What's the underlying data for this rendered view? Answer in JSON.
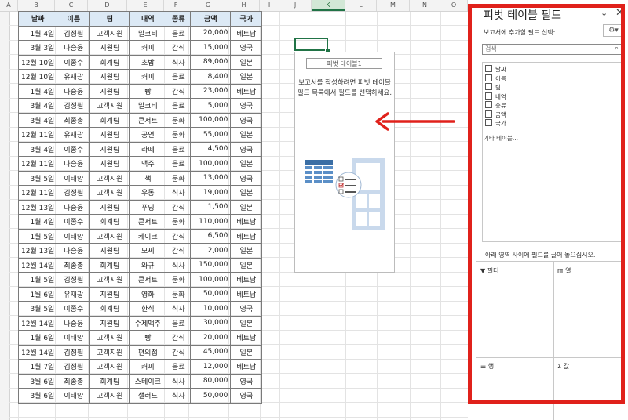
{
  "columns": [
    "A",
    "B",
    "C",
    "D",
    "E",
    "F",
    "G",
    "H",
    "I",
    "J",
    "K",
    "L",
    "M",
    "N",
    "O"
  ],
  "selected_column": "K",
  "table": {
    "headers": [
      "날짜",
      "이름",
      "팀",
      "내역",
      "종류",
      "금액",
      "국가"
    ],
    "rows": [
      [
        "1월 4일",
        "김정필",
        "고객지원",
        "밀크티",
        "음료",
        "20,000",
        "베트남"
      ],
      [
        "3월 3일",
        "나승윤",
        "지원팀",
        "커피",
        "간식",
        "15,000",
        "영국"
      ],
      [
        "12월 10일",
        "이종수",
        "회계팀",
        "초밥",
        "식사",
        "89,000",
        "일본"
      ],
      [
        "12월 10일",
        "유재광",
        "지원팀",
        "커피",
        "음료",
        "8,400",
        "일본"
      ],
      [
        "1월 4일",
        "나승윤",
        "지원팀",
        "빵",
        "간식",
        "23,000",
        "베트남"
      ],
      [
        "3월 4일",
        "김정필",
        "고객지원",
        "밀크티",
        "음료",
        "5,000",
        "영국"
      ],
      [
        "3월 4일",
        "최종총",
        "회계팀",
        "콘서트",
        "문화",
        "100,000",
        "영국"
      ],
      [
        "12월 11일",
        "유재광",
        "지원팀",
        "공연",
        "문화",
        "55,000",
        "일본"
      ],
      [
        "3월 4일",
        "이종수",
        "지원팀",
        "라떼",
        "음료",
        "4,500",
        "영국"
      ],
      [
        "12월 11일",
        "나승윤",
        "지원팀",
        "맥주",
        "음료",
        "100,000",
        "일본"
      ],
      [
        "3월 5일",
        "이태양",
        "고객지원",
        "책",
        "문화",
        "13,000",
        "영국"
      ],
      [
        "12월 11일",
        "김정필",
        "고객지원",
        "우동",
        "식사",
        "19,000",
        "일본"
      ],
      [
        "12월 13일",
        "나승윤",
        "지원팀",
        "푸딩",
        "간식",
        "1,500",
        "일본"
      ],
      [
        "1월 4일",
        "이종수",
        "회계팀",
        "콘서트",
        "문화",
        "110,000",
        "베트남"
      ],
      [
        "1월 5일",
        "이태양",
        "고객지원",
        "케이크",
        "간식",
        "6,500",
        "베트남"
      ],
      [
        "12월 13일",
        "나승윤",
        "지원팀",
        "모찌",
        "간식",
        "2,000",
        "일본"
      ],
      [
        "12월 14일",
        "최종총",
        "회계팀",
        "와규",
        "식사",
        "150,000",
        "일본"
      ],
      [
        "1월 5일",
        "김정필",
        "고객지원",
        "콘서트",
        "문화",
        "100,000",
        "베트남"
      ],
      [
        "1월 6일",
        "유재광",
        "지원팀",
        "영화",
        "문화",
        "50,000",
        "베트남"
      ],
      [
        "3월 5일",
        "이종수",
        "회계팀",
        "한식",
        "식사",
        "10,000",
        "영국"
      ],
      [
        "12월 14일",
        "나승윤",
        "지원팀",
        "수제맥주",
        "음료",
        "30,000",
        "일본"
      ],
      [
        "1월 6일",
        "이태양",
        "고객지원",
        "빵",
        "간식",
        "20,000",
        "베트남"
      ],
      [
        "12월 14일",
        "김정필",
        "고객지원",
        "편의점",
        "간식",
        "45,000",
        "일본"
      ],
      [
        "1월 7일",
        "김정필",
        "고객지원",
        "커피",
        "음료",
        "12,000",
        "베트남"
      ],
      [
        "3월 6일",
        "최종총",
        "회계팀",
        "스테이크",
        "식사",
        "80,000",
        "영국"
      ],
      [
        "3월 6일",
        "이태양",
        "고객지원",
        "샐러드",
        "식사",
        "50,000",
        "영국"
      ]
    ]
  },
  "pivot": {
    "title": "피벗 테이블1",
    "message": "보고서를 작성하려면 피벗 테이블 필드 목록에서 필드를 선택하세요."
  },
  "panel": {
    "title": "피벗 테이블 필드",
    "subtitle": "보고서에 추가할 필드 선택:",
    "search_placeholder": "검색",
    "fields": [
      "날짜",
      "이름",
      "팀",
      "내역",
      "종류",
      "금액",
      "국가"
    ],
    "more_tables": "기타 테이블...",
    "drag_hint": "아래 영역 사이에 필드를 끌어 놓으십시오.",
    "areas": {
      "filter": "필터",
      "columns": "열",
      "rows": "행",
      "values": "값"
    }
  },
  "colors": {
    "highlight": "#e0211b",
    "excel_green": "#217346",
    "header_fill": "#dce9f5"
  }
}
